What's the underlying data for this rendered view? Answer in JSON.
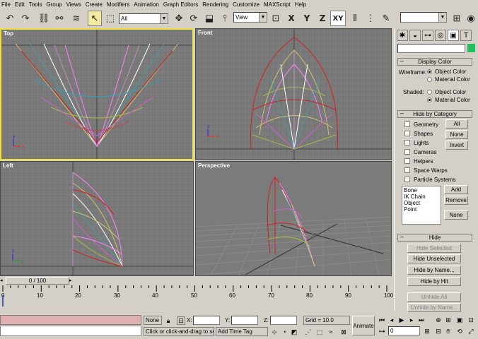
{
  "menu": [
    "File",
    "Edit",
    "Tools",
    "Group",
    "Views",
    "Create",
    "Modifiers",
    "Animation",
    "Graph Editors",
    "Rendering",
    "Customize",
    "MAXScript",
    "Help"
  ],
  "toolbar": {
    "selection_filter": "All",
    "reference_coord": "View",
    "axis_x": "X",
    "axis_y": "Y",
    "axis_z": "Z",
    "axis_xy": "XY"
  },
  "viewports": {
    "top": "Top",
    "front": "Front",
    "left": "Left",
    "perspective": "Perspective"
  },
  "panel": {
    "display_color_title": "Display Color",
    "wireframe_label": "Wireframe:",
    "shaded_label": "Shaded:",
    "object_color": "Object Color",
    "material_color": "Material Color",
    "hide_by_category_title": "Hide by Category",
    "categories": [
      "Geometry",
      "Shapes",
      "Lights",
      "Cameras",
      "Helpers",
      "Space Warps",
      "Particle Systems"
    ],
    "all_btn": "All",
    "none_btn": "None",
    "invert_btn": "Invert",
    "list_items": [
      "Bone",
      "IK Chain Object",
      "Point"
    ],
    "add_btn": "Add",
    "remove_btn": "Remove",
    "none2_btn": "None",
    "hide_title": "Hide",
    "hide_selected": "Hide Selected",
    "hide_unselected": "Hide Unselected",
    "hide_by_name": "Hide by Name...",
    "hide_by_hit": "Hide by Hit",
    "unhide_all": "Unhide All",
    "unhide_by_name": "Unhide by Name..."
  },
  "timeline": {
    "frame_label": "0 / 100",
    "ticks": [
      "0",
      "10",
      "20",
      "30",
      "40",
      "50",
      "60",
      "70",
      "80",
      "90",
      "100"
    ]
  },
  "status": {
    "selection": "None S",
    "x_label": "X:",
    "y_label": "Y:",
    "z_label": "Z:",
    "grid": "Grid = 10.0",
    "prompt": "Click or click-and-drag to selec",
    "add_time_tag": "Add Time Tag",
    "animate": "Animate",
    "frame_field": "0"
  },
  "colors": {
    "viewport_bg": "#7b7b7b",
    "active_border": "#f0e040",
    "ui_gray": "#d4d0c8"
  }
}
